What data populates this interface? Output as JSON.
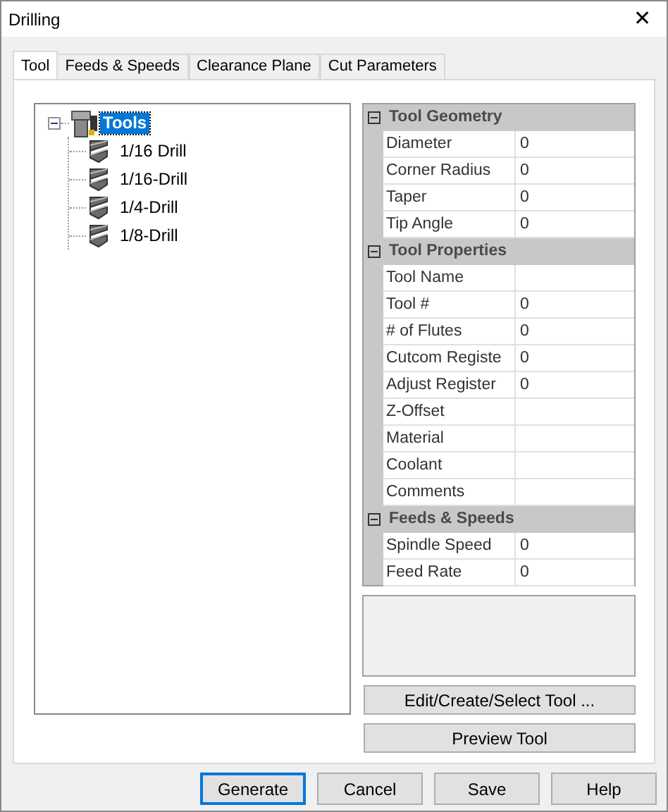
{
  "window": {
    "title": "Drilling",
    "close": "✕"
  },
  "tabs": [
    {
      "label": "Tool",
      "selected": true
    },
    {
      "label": "Feeds & Speeds",
      "selected": false
    },
    {
      "label": "Clearance Plane",
      "selected": false
    },
    {
      "label": "Cut Parameters",
      "selected": false
    }
  ],
  "tree": {
    "label": "Tools",
    "selected": true,
    "expanded": true,
    "children": [
      {
        "label": "1/16 Drill",
        "selected": false
      },
      {
        "label": "1/16-Drill",
        "selected": false
      },
      {
        "label": "1/4-Drill",
        "selected": false
      },
      {
        "label": "1/8-Drill",
        "selected": false
      }
    ]
  },
  "properties": [
    {
      "category": "Tool Geometry",
      "expanded": true,
      "rows": [
        {
          "label": "Diameter",
          "value": "0"
        },
        {
          "label": "Corner Radius",
          "value": "0"
        },
        {
          "label": "Taper",
          "value": "0"
        },
        {
          "label": "Tip Angle",
          "value": "0"
        }
      ]
    },
    {
      "category": "Tool Properties",
      "expanded": true,
      "rows": [
        {
          "label": "Tool Name"
        },
        {
          "label": "Tool #",
          "value": "0"
        },
        {
          "label": "# of Flutes",
          "value": "0"
        },
        {
          "label": "Cutcom Registe",
          "value": "0"
        },
        {
          "label": "Adjust Register",
          "value": "0"
        },
        {
          "label": "Z-Offset"
        },
        {
          "label": "Material"
        },
        {
          "label": "Coolant"
        },
        {
          "label": "Comments"
        }
      ]
    },
    {
      "category": "Feeds & Speeds",
      "expanded": true,
      "rows": [
        {
          "label": "Spindle Speed",
          "value": "0"
        },
        {
          "label": "Feed Rate",
          "value": "0"
        }
      ]
    }
  ],
  "side_buttons": [
    "Edit/Create/Select Tool ...",
    "Preview Tool"
  ],
  "footer_buttons": [
    {
      "label": "Generate",
      "default": true
    },
    {
      "label": "Cancel",
      "default": false
    },
    {
      "label": "Save",
      "default": false
    },
    {
      "label": "Help",
      "default": false
    }
  ]
}
